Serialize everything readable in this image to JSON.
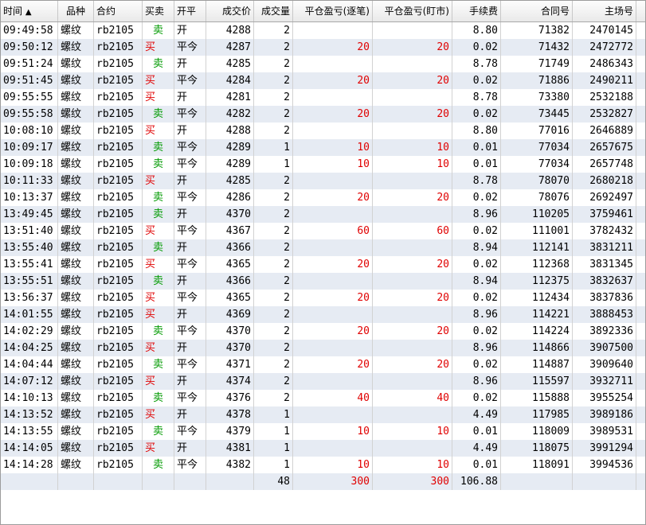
{
  "colors": {
    "buy": "#e00000",
    "sell": "#009a00",
    "profit": "#e00000",
    "alt_row": "#e6ebf3"
  },
  "headers": {
    "time": "时间",
    "sort_indicator": "▲",
    "variety": "品种",
    "contract": "合约",
    "side": "买卖",
    "open_close": "开平",
    "price": "成交价",
    "volume": "成交量",
    "close_pnl_trade": "平仓盈亏(逐笔)",
    "close_pnl_mtm": "平仓盈亏(盯市)",
    "fee": "手续费",
    "contract_no": "合同号",
    "exchange_no": "主场号"
  },
  "rows": [
    {
      "time": "09:49:58",
      "variety": "螺纹",
      "contract": "rb2105",
      "side": "卖",
      "side_type": "sell",
      "oc": "开",
      "price": "4288",
      "vol": "2",
      "pnl1": "",
      "pnl2": "",
      "fee": "8.80",
      "cno": "71382",
      "eno": "2470145"
    },
    {
      "time": "09:50:12",
      "variety": "螺纹",
      "contract": "rb2105",
      "side": "买",
      "side_type": "buy",
      "oc": "平今",
      "price": "4287",
      "vol": "2",
      "pnl1": "20",
      "pnl2": "20",
      "fee": "0.02",
      "cno": "71432",
      "eno": "2472772"
    },
    {
      "time": "09:51:24",
      "variety": "螺纹",
      "contract": "rb2105",
      "side": "卖",
      "side_type": "sell",
      "oc": "开",
      "price": "4285",
      "vol": "2",
      "pnl1": "",
      "pnl2": "",
      "fee": "8.78",
      "cno": "71749",
      "eno": "2486343"
    },
    {
      "time": "09:51:45",
      "variety": "螺纹",
      "contract": "rb2105",
      "side": "买",
      "side_type": "buy",
      "oc": "平今",
      "price": "4284",
      "vol": "2",
      "pnl1": "20",
      "pnl2": "20",
      "fee": "0.02",
      "cno": "71886",
      "eno": "2490211"
    },
    {
      "time": "09:55:55",
      "variety": "螺纹",
      "contract": "rb2105",
      "side": "买",
      "side_type": "buy",
      "oc": "开",
      "price": "4281",
      "vol": "2",
      "pnl1": "",
      "pnl2": "",
      "fee": "8.78",
      "cno": "73380",
      "eno": "2532188"
    },
    {
      "time": "09:55:58",
      "variety": "螺纹",
      "contract": "rb2105",
      "side": "卖",
      "side_type": "sell",
      "oc": "平今",
      "price": "4282",
      "vol": "2",
      "pnl1": "20",
      "pnl2": "20",
      "fee": "0.02",
      "cno": "73445",
      "eno": "2532827"
    },
    {
      "time": "10:08:10",
      "variety": "螺纹",
      "contract": "rb2105",
      "side": "买",
      "side_type": "buy",
      "oc": "开",
      "price": "4288",
      "vol": "2",
      "pnl1": "",
      "pnl2": "",
      "fee": "8.80",
      "cno": "77016",
      "eno": "2646889"
    },
    {
      "time": "10:09:17",
      "variety": "螺纹",
      "contract": "rb2105",
      "side": "卖",
      "side_type": "sell",
      "oc": "平今",
      "price": "4289",
      "vol": "1",
      "pnl1": "10",
      "pnl2": "10",
      "fee": "0.01",
      "cno": "77034",
      "eno": "2657675"
    },
    {
      "time": "10:09:18",
      "variety": "螺纹",
      "contract": "rb2105",
      "side": "卖",
      "side_type": "sell",
      "oc": "平今",
      "price": "4289",
      "vol": "1",
      "pnl1": "10",
      "pnl2": "10",
      "fee": "0.01",
      "cno": "77034",
      "eno": "2657748"
    },
    {
      "time": "10:11:33",
      "variety": "螺纹",
      "contract": "rb2105",
      "side": "买",
      "side_type": "buy",
      "oc": "开",
      "price": "4285",
      "vol": "2",
      "pnl1": "",
      "pnl2": "",
      "fee": "8.78",
      "cno": "78070",
      "eno": "2680218"
    },
    {
      "time": "10:13:37",
      "variety": "螺纹",
      "contract": "rb2105",
      "side": "卖",
      "side_type": "sell",
      "oc": "平今",
      "price": "4286",
      "vol": "2",
      "pnl1": "20",
      "pnl2": "20",
      "fee": "0.02",
      "cno": "78076",
      "eno": "2692497"
    },
    {
      "time": "13:49:45",
      "variety": "螺纹",
      "contract": "rb2105",
      "side": "卖",
      "side_type": "sell",
      "oc": "开",
      "price": "4370",
      "vol": "2",
      "pnl1": "",
      "pnl2": "",
      "fee": "8.96",
      "cno": "110205",
      "eno": "3759461"
    },
    {
      "time": "13:51:40",
      "variety": "螺纹",
      "contract": "rb2105",
      "side": "买",
      "side_type": "buy",
      "oc": "平今",
      "price": "4367",
      "vol": "2",
      "pnl1": "60",
      "pnl2": "60",
      "fee": "0.02",
      "cno": "111001",
      "eno": "3782432"
    },
    {
      "time": "13:55:40",
      "variety": "螺纹",
      "contract": "rb2105",
      "side": "卖",
      "side_type": "sell",
      "oc": "开",
      "price": "4366",
      "vol": "2",
      "pnl1": "",
      "pnl2": "",
      "fee": "8.94",
      "cno": "112141",
      "eno": "3831211"
    },
    {
      "time": "13:55:41",
      "variety": "螺纹",
      "contract": "rb2105",
      "side": "买",
      "side_type": "buy",
      "oc": "平今",
      "price": "4365",
      "vol": "2",
      "pnl1": "20",
      "pnl2": "20",
      "fee": "0.02",
      "cno": "112368",
      "eno": "3831345"
    },
    {
      "time": "13:55:51",
      "variety": "螺纹",
      "contract": "rb2105",
      "side": "卖",
      "side_type": "sell",
      "oc": "开",
      "price": "4366",
      "vol": "2",
      "pnl1": "",
      "pnl2": "",
      "fee": "8.94",
      "cno": "112375",
      "eno": "3832637"
    },
    {
      "time": "13:56:37",
      "variety": "螺纹",
      "contract": "rb2105",
      "side": "买",
      "side_type": "buy",
      "oc": "平今",
      "price": "4365",
      "vol": "2",
      "pnl1": "20",
      "pnl2": "20",
      "fee": "0.02",
      "cno": "112434",
      "eno": "3837836"
    },
    {
      "time": "14:01:55",
      "variety": "螺纹",
      "contract": "rb2105",
      "side": "买",
      "side_type": "buy",
      "oc": "开",
      "price": "4369",
      "vol": "2",
      "pnl1": "",
      "pnl2": "",
      "fee": "8.96",
      "cno": "114221",
      "eno": "3888453"
    },
    {
      "time": "14:02:29",
      "variety": "螺纹",
      "contract": "rb2105",
      "side": "卖",
      "side_type": "sell",
      "oc": "平今",
      "price": "4370",
      "vol": "2",
      "pnl1": "20",
      "pnl2": "20",
      "fee": "0.02",
      "cno": "114224",
      "eno": "3892336"
    },
    {
      "time": "14:04:25",
      "variety": "螺纹",
      "contract": "rb2105",
      "side": "买",
      "side_type": "buy",
      "oc": "开",
      "price": "4370",
      "vol": "2",
      "pnl1": "",
      "pnl2": "",
      "fee": "8.96",
      "cno": "114866",
      "eno": "3907500"
    },
    {
      "time": "14:04:44",
      "variety": "螺纹",
      "contract": "rb2105",
      "side": "卖",
      "side_type": "sell",
      "oc": "平今",
      "price": "4371",
      "vol": "2",
      "pnl1": "20",
      "pnl2": "20",
      "fee": "0.02",
      "cno": "114887",
      "eno": "3909640"
    },
    {
      "time": "14:07:12",
      "variety": "螺纹",
      "contract": "rb2105",
      "side": "买",
      "side_type": "buy",
      "oc": "开",
      "price": "4374",
      "vol": "2",
      "pnl1": "",
      "pnl2": "",
      "fee": "8.96",
      "cno": "115597",
      "eno": "3932711"
    },
    {
      "time": "14:10:13",
      "variety": "螺纹",
      "contract": "rb2105",
      "side": "卖",
      "side_type": "sell",
      "oc": "平今",
      "price": "4376",
      "vol": "2",
      "pnl1": "40",
      "pnl2": "40",
      "fee": "0.02",
      "cno": "115888",
      "eno": "3955254"
    },
    {
      "time": "14:13:52",
      "variety": "螺纹",
      "contract": "rb2105",
      "side": "买",
      "side_type": "buy",
      "oc": "开",
      "price": "4378",
      "vol": "1",
      "pnl1": "",
      "pnl2": "",
      "fee": "4.49",
      "cno": "117985",
      "eno": "3989186"
    },
    {
      "time": "14:13:55",
      "variety": "螺纹",
      "contract": "rb2105",
      "side": "卖",
      "side_type": "sell",
      "oc": "平今",
      "price": "4379",
      "vol": "1",
      "pnl1": "10",
      "pnl2": "10",
      "fee": "0.01",
      "cno": "118009",
      "eno": "3989531"
    },
    {
      "time": "14:14:05",
      "variety": "螺纹",
      "contract": "rb2105",
      "side": "买",
      "side_type": "buy",
      "oc": "开",
      "price": "4381",
      "vol": "1",
      "pnl1": "",
      "pnl2": "",
      "fee": "4.49",
      "cno": "118075",
      "eno": "3991294"
    },
    {
      "time": "14:14:28",
      "variety": "螺纹",
      "contract": "rb2105",
      "side": "卖",
      "side_type": "sell",
      "oc": "平今",
      "price": "4382",
      "vol": "1",
      "pnl1": "10",
      "pnl2": "10",
      "fee": "0.01",
      "cno": "118091",
      "eno": "3994536"
    }
  ],
  "summary": {
    "vol": "48",
    "pnl1": "300",
    "pnl2": "300",
    "fee": "106.88"
  }
}
